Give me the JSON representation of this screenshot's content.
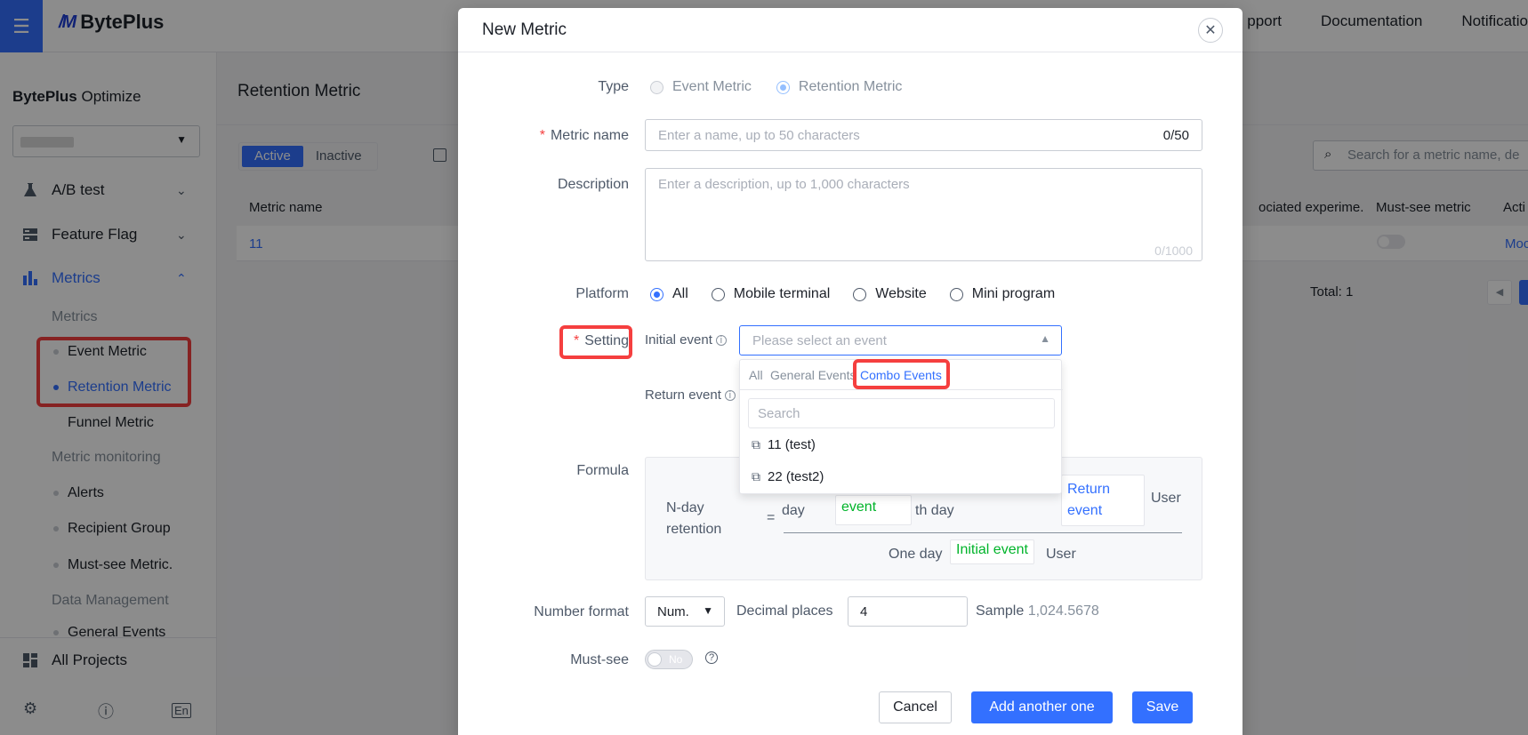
{
  "app": {
    "brand": "BytePlus",
    "top_nav": [
      "pport",
      "Documentation",
      "Notificatio"
    ],
    "product_title_bold": "BytePlus",
    "product_title_rest": " Optimize"
  },
  "sidebar": {
    "items": [
      {
        "label": "A/B test",
        "icon": "flask-icon"
      },
      {
        "label": "Feature Flag",
        "icon": "flag-icon"
      },
      {
        "label": "Metrics",
        "icon": "bar-chart-icon"
      }
    ],
    "metrics_group": "Metrics",
    "metrics_items": [
      "Event Metric",
      "Retention Metric",
      "Funnel Metric"
    ],
    "monitoring_group": "Metric monitoring",
    "monitoring_items": [
      "Alerts",
      "Recipient Group",
      "Must-see Metric."
    ],
    "data_group": "Data Management",
    "data_items": [
      "General Events"
    ],
    "all_projects": "All Projects",
    "lang": "En"
  },
  "content": {
    "title": "Retention Metric",
    "tabs": [
      "Active",
      "Inactive"
    ],
    "search_placeholder": "Search for a metric name, de",
    "columns": [
      "Metric name",
      "ociated experime.",
      "Must-see metric",
      "Acti"
    ],
    "rows": [
      {
        "name": "11",
        "action": "Moc"
      }
    ],
    "total": "Total: 1"
  },
  "modal": {
    "title": "New Metric",
    "type_label": "Type",
    "type_options": [
      "Event Metric",
      "Retention Metric"
    ],
    "name_label": "Metric name",
    "name_placeholder": "Enter a name, up to 50 characters",
    "name_count": "0/50",
    "desc_label": "Description",
    "desc_placeholder": "Enter a description, up to 1,000 characters",
    "desc_count": "0/1000",
    "platform_label": "Platform",
    "platform_options": [
      "All",
      "Mobile terminal",
      "Website",
      "Mini program"
    ],
    "setting_label": "Setting",
    "initial_event_label": "Initial event",
    "initial_event_placeholder": "Please select an event",
    "return_event_label": "Return event",
    "formula_label": "Formula",
    "formula": {
      "left": "N-day retention",
      "eq": "=",
      "day": "day",
      "event": "event",
      "th_day": "th day",
      "return_event": "Return event",
      "user": "User",
      "one_day": "One day",
      "initial_event": "Initial event",
      "user2": "User"
    },
    "number_format_label": "Number format",
    "number_format_value": "Num.",
    "decimal_label": "Decimal places",
    "decimal_value": "4",
    "sample_label": "Sample",
    "sample_value": "1,024.5678",
    "mustsee_label": "Must-see",
    "mustsee_toggle": "No",
    "buttons": {
      "cancel": "Cancel",
      "add_another": "Add another one",
      "save": "Save"
    }
  },
  "dropdown": {
    "tabs": [
      "All",
      "General Events",
      "Combo Events"
    ],
    "search_placeholder": "Search",
    "options": [
      "11 (test)",
      "22 (test2)"
    ]
  },
  "colors": {
    "accent": "#3370ff",
    "highlight": "#f53f3f",
    "success": "#00b42a"
  }
}
